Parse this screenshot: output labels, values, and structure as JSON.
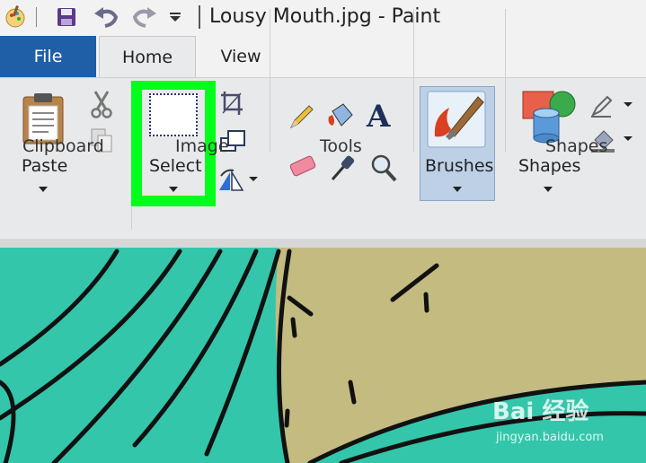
{
  "window": {
    "title": "Lousy Mouth.jpg - Paint"
  },
  "quick_access": {
    "icons": [
      "paint-app-icon",
      "save-icon",
      "undo-icon",
      "redo-icon",
      "customize-dropdown-icon"
    ]
  },
  "tabs": [
    {
      "label": "File"
    },
    {
      "label": "Home"
    },
    {
      "label": "View"
    }
  ],
  "ribbon": {
    "clipboard": {
      "group_label": "Clipboard",
      "paste_label": "Paste"
    },
    "image": {
      "group_label": "Image",
      "select_label": "Select"
    },
    "tools": {
      "group_label": "Tools",
      "text_tool_glyph": "A"
    },
    "brushes": {
      "label": "Brushes"
    },
    "shapes": {
      "group_label": "Shapes",
      "shapes_label": "Shapes"
    }
  },
  "colors": {
    "file_tab": "#1f5fa8",
    "highlight": "#00ff1a",
    "canvas_bg": "#c3bb80",
    "canvas_teal": "#33c6aa"
  },
  "watermark": {
    "text": "Bai 经验",
    "url": "jingyan.baidu.com"
  }
}
